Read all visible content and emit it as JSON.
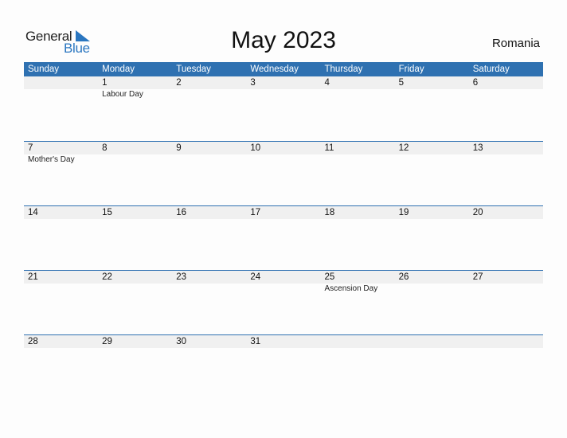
{
  "logo": {
    "general": "General",
    "blue": "Blue"
  },
  "title": "May 2023",
  "country": "Romania",
  "colors": {
    "header_bg": "#2f71b1",
    "date_strip": "#f0f0f0",
    "brand_blue": "#2a76c0"
  },
  "weekdays": [
    "Sunday",
    "Monday",
    "Tuesday",
    "Wednesday",
    "Thursday",
    "Friday",
    "Saturday"
  ],
  "weeks": [
    [
      {
        "d": ""
      },
      {
        "d": "1",
        "h": "Labour Day"
      },
      {
        "d": "2"
      },
      {
        "d": "3"
      },
      {
        "d": "4"
      },
      {
        "d": "5"
      },
      {
        "d": "6"
      }
    ],
    [
      {
        "d": "7",
        "h": "Mother's Day"
      },
      {
        "d": "8"
      },
      {
        "d": "9"
      },
      {
        "d": "10"
      },
      {
        "d": "11"
      },
      {
        "d": "12"
      },
      {
        "d": "13"
      }
    ],
    [
      {
        "d": "14"
      },
      {
        "d": "15"
      },
      {
        "d": "16"
      },
      {
        "d": "17"
      },
      {
        "d": "18"
      },
      {
        "d": "19"
      },
      {
        "d": "20"
      }
    ],
    [
      {
        "d": "21"
      },
      {
        "d": "22"
      },
      {
        "d": "23"
      },
      {
        "d": "24"
      },
      {
        "d": "25",
        "h": "Ascension Day"
      },
      {
        "d": "26"
      },
      {
        "d": "27"
      }
    ],
    [
      {
        "d": "28"
      },
      {
        "d": "29"
      },
      {
        "d": "30"
      },
      {
        "d": "31"
      },
      {
        "d": ""
      },
      {
        "d": ""
      },
      {
        "d": ""
      }
    ]
  ]
}
